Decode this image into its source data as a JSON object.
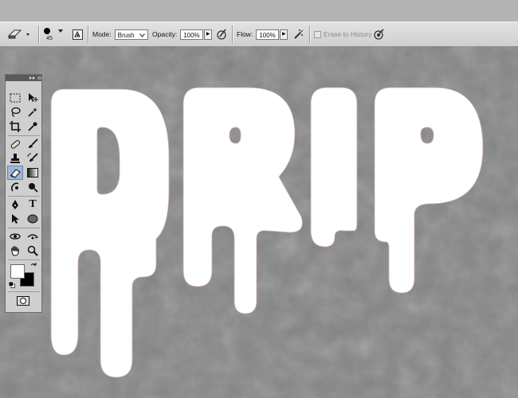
{
  "options_bar": {
    "brush_size": "45",
    "mode_label": "Mode:",
    "mode_value": "Brush",
    "opacity_label": "Opacity:",
    "opacity_value": "100%",
    "flow_label": "Flow:",
    "flow_value": "100%",
    "erase_to_history_label": "Erase to History",
    "erase_to_history_checked": false
  },
  "tools": [
    {
      "name": "marquee-tool"
    },
    {
      "name": "move-tool"
    },
    {
      "name": "lasso-tool"
    },
    {
      "name": "magic-wand-tool"
    },
    {
      "name": "crop-tool"
    },
    {
      "name": "eyedropper-tool"
    },
    {
      "name": "healing-brush-tool"
    },
    {
      "name": "brush-tool"
    },
    {
      "name": "clone-stamp-tool"
    },
    {
      "name": "history-brush-tool"
    },
    {
      "name": "eraser-tool",
      "active": true
    },
    {
      "name": "gradient-tool"
    },
    {
      "name": "blur-tool"
    },
    {
      "name": "dodge-tool"
    },
    {
      "name": "pen-tool"
    },
    {
      "name": "type-tool"
    },
    {
      "name": "path-selection-tool"
    },
    {
      "name": "shape-tool"
    },
    {
      "name": "3d-rotate-tool"
    },
    {
      "name": "3d-orbit-tool"
    },
    {
      "name": "hand-tool"
    },
    {
      "name": "zoom-tool"
    }
  ],
  "type_tool_glyph": "T",
  "colors": {
    "foreground": "#ffffff",
    "background": "#000000",
    "active_tool_bg": "#9fb6d6",
    "canvas_text": "#ffffff"
  }
}
